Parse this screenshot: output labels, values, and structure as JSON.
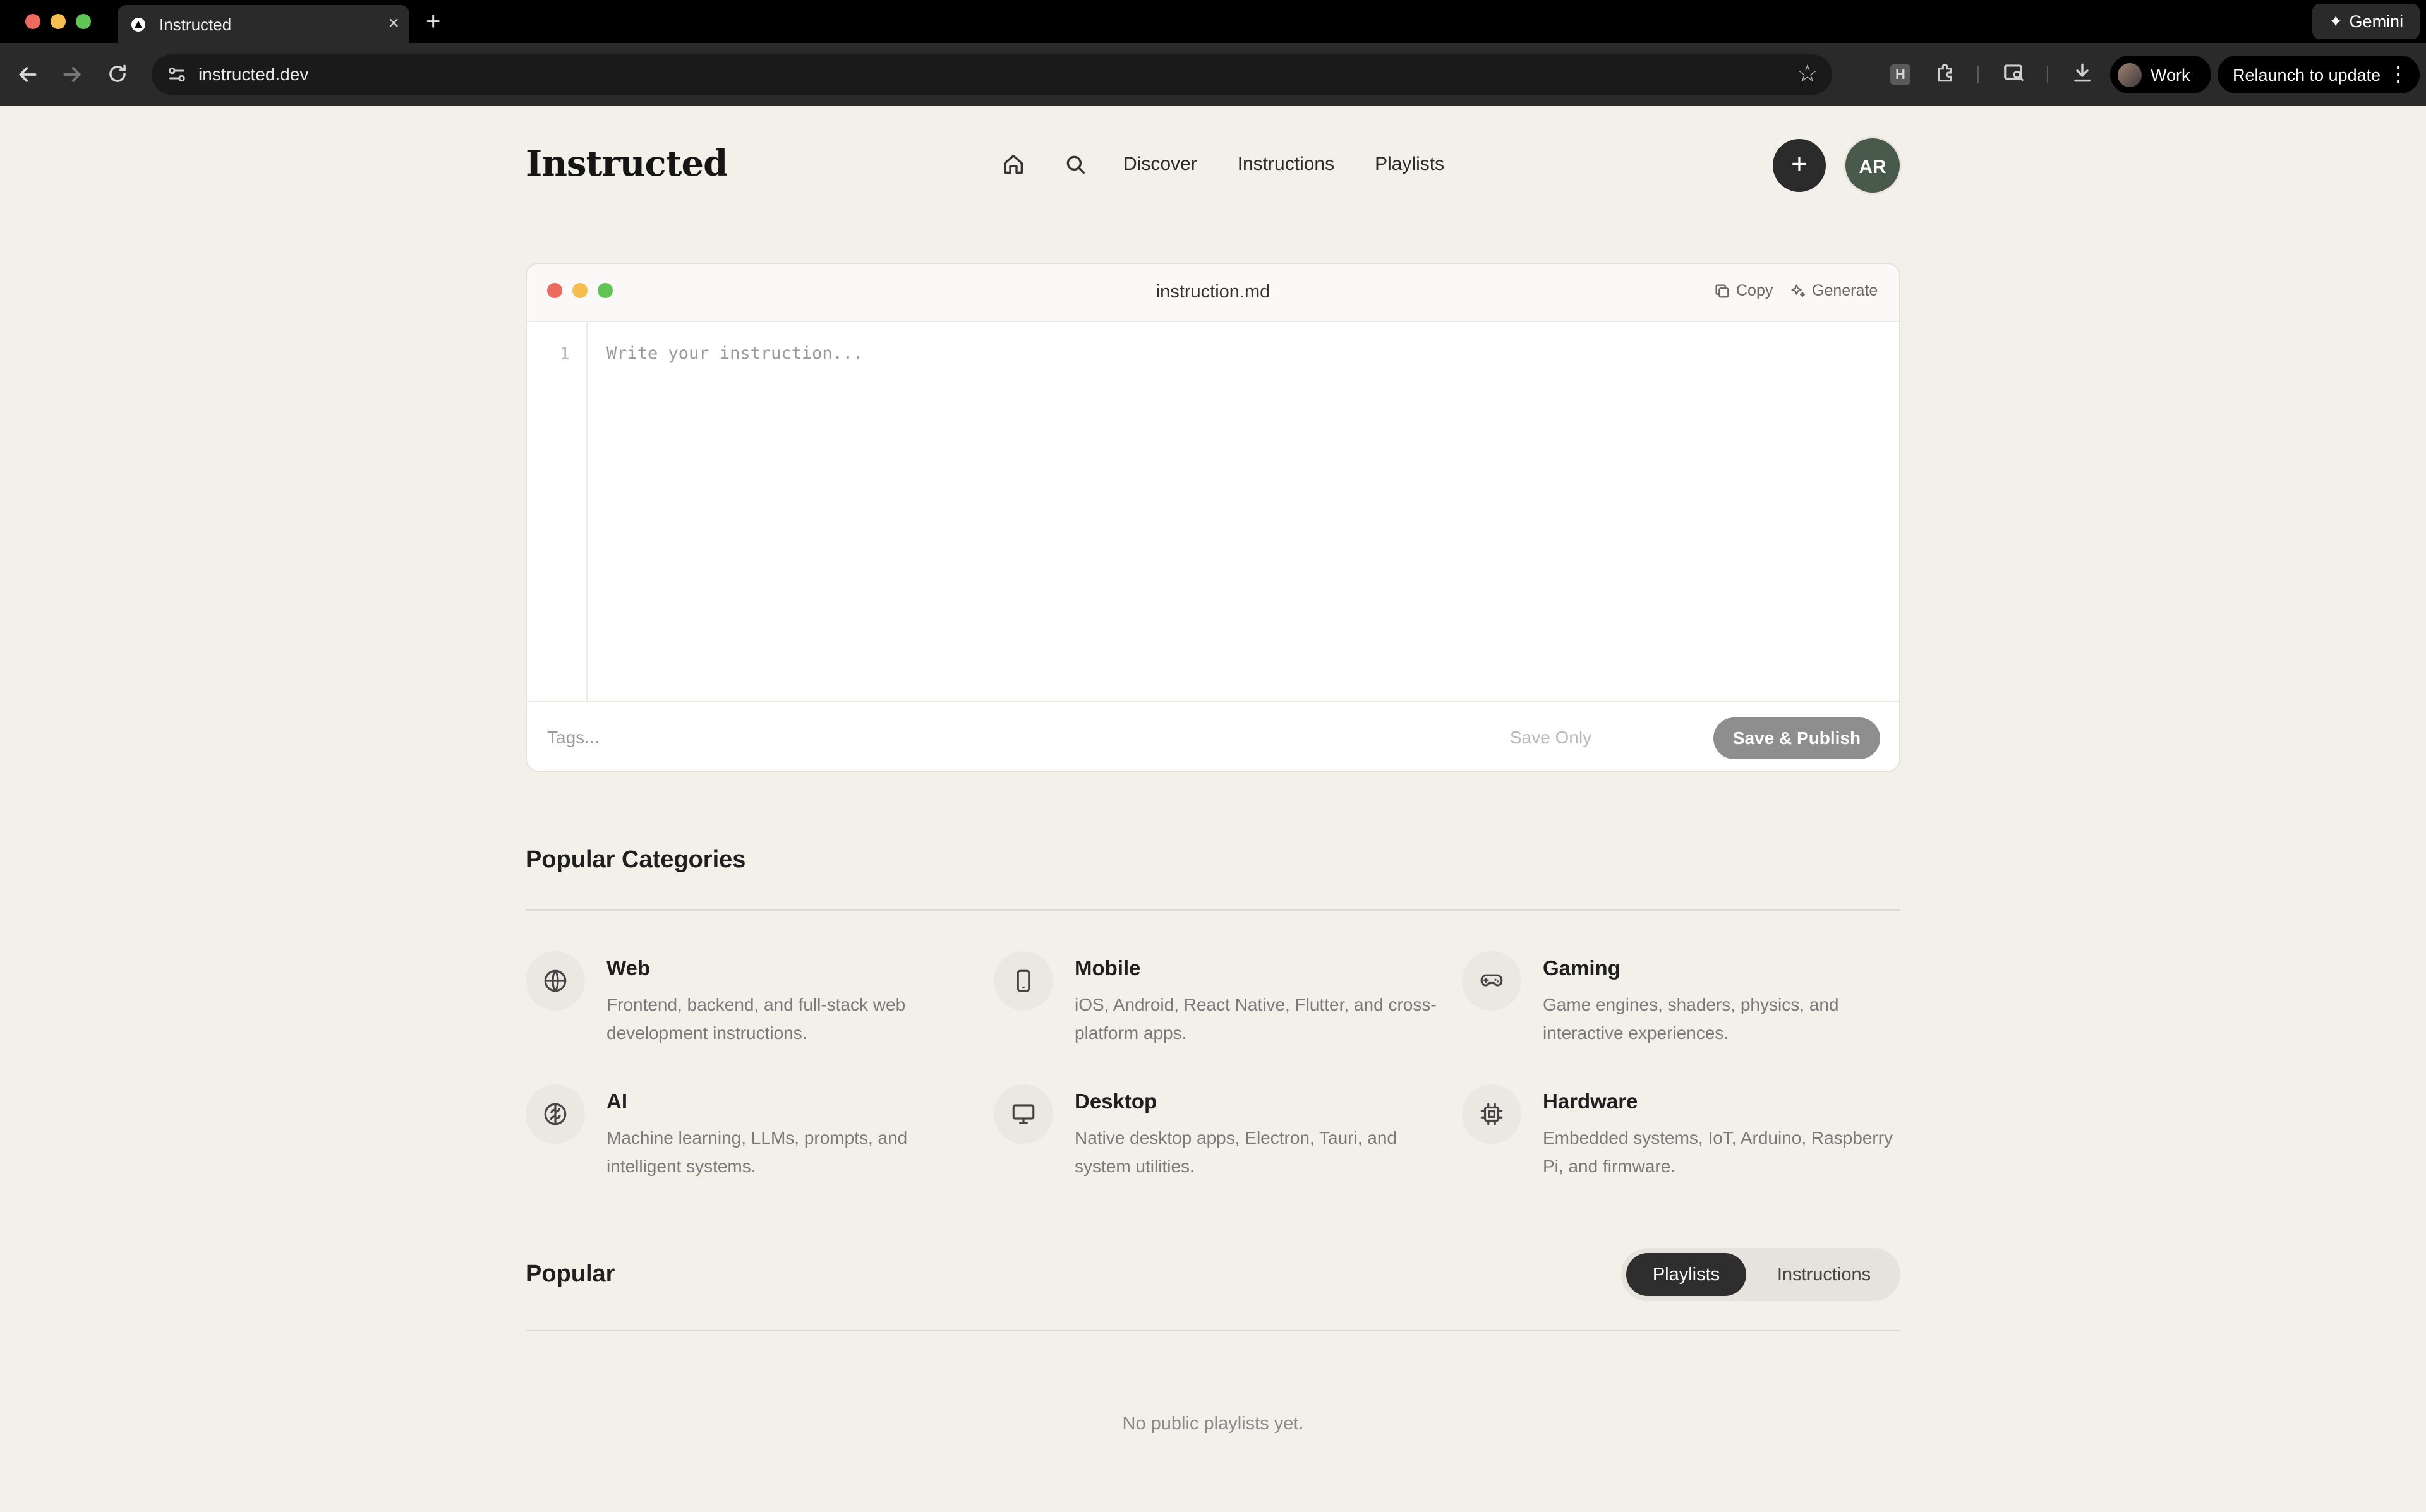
{
  "browser": {
    "tab_title": "Instructed",
    "url": "instructed.dev",
    "gemini_label": "Gemini",
    "profile_label": "Work",
    "relaunch_label": "Relaunch to update"
  },
  "header": {
    "logo": "Instructed",
    "nav": [
      "Discover",
      "Instructions",
      "Playlists"
    ],
    "avatar_initials": "AR"
  },
  "editor": {
    "filename": "instruction.md",
    "copy_label": "Copy",
    "generate_label": "Generate",
    "line_number": "1",
    "placeholder": "Write your instruction...",
    "tags_placeholder": "Tags...",
    "save_only_label": "Save Only",
    "publish_label": "Save & Publish"
  },
  "categories": {
    "title": "Popular Categories",
    "items": [
      {
        "name": "Web",
        "desc": "Frontend, backend, and full-stack web development instructions.",
        "icon": "globe-icon"
      },
      {
        "name": "Mobile",
        "desc": "iOS, Android, React Native, Flutter, and cross-platform apps.",
        "icon": "phone-icon"
      },
      {
        "name": "Gaming",
        "desc": "Game engines, shaders, physics, and interactive experiences.",
        "icon": "gamepad-icon"
      },
      {
        "name": "AI",
        "desc": "Machine learning, LLMs, prompts, and intelligent systems.",
        "icon": "brain-icon"
      },
      {
        "name": "Desktop",
        "desc": "Native desktop apps, Electron, Tauri, and system utilities.",
        "icon": "monitor-icon"
      },
      {
        "name": "Hardware",
        "desc": "Embedded systems, IoT, Arduino, Raspberry Pi, and firmware.",
        "icon": "chip-icon"
      }
    ]
  },
  "popular": {
    "title": "Popular",
    "tabs": [
      "Playlists",
      "Instructions"
    ],
    "empty_text": "No public playlists yet."
  },
  "colors": {
    "page_bg": "#f3efe9",
    "accent_dark": "#2b2b2b",
    "avatar_bg": "#4a5a4a",
    "close_dot": "#ec6a5e",
    "min_dot": "#f4bf4f",
    "max_dot": "#61c554"
  }
}
